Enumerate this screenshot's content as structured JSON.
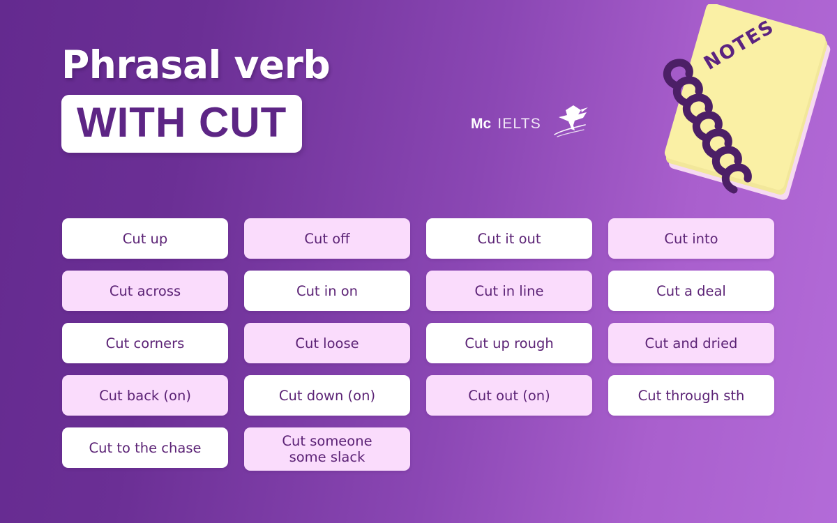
{
  "theme": {
    "bg_gradient_start": "#642a8f",
    "bg_gradient_end": "#b36bd8",
    "card_white": "#ffffff",
    "card_pink": "#fadcfc",
    "text_purple": "#5b2275",
    "notebook_yellow": "#faf0a5",
    "notebook_spiral": "#4c1f66"
  },
  "header": {
    "title_line1": "Phrasal verb",
    "title_line2": "WITH CUT"
  },
  "logo": {
    "mc": "Mc",
    "ielts": "IELTS",
    "bird_icon": "origami-bird-icon"
  },
  "notebook": {
    "label": "NOTES",
    "icon": "spiral-notebook-icon"
  },
  "grid": {
    "columns": 4,
    "cards": [
      {
        "label": "Cut up",
        "style": "white",
        "lines": 1
      },
      {
        "label": "Cut off",
        "style": "pink",
        "lines": 1
      },
      {
        "label": "Cut it out",
        "style": "white",
        "lines": 1
      },
      {
        "label": "Cut into",
        "style": "pink",
        "lines": 1
      },
      {
        "label": "Cut across",
        "style": "pink",
        "lines": 1
      },
      {
        "label": "Cut in on",
        "style": "white",
        "lines": 1
      },
      {
        "label": "Cut in line",
        "style": "pink",
        "lines": 1
      },
      {
        "label": "Cut a deal",
        "style": "white",
        "lines": 1
      },
      {
        "label": "Cut corners",
        "style": "white",
        "lines": 1
      },
      {
        "label": "Cut loose",
        "style": "pink",
        "lines": 1
      },
      {
        "label": "Cut up rough",
        "style": "white",
        "lines": 1
      },
      {
        "label": "Cut and dried",
        "style": "pink",
        "lines": 1
      },
      {
        "label": "Cut back (on)",
        "style": "pink",
        "lines": 1
      },
      {
        "label": "Cut down (on)",
        "style": "white",
        "lines": 1
      },
      {
        "label": "Cut out (on)",
        "style": "pink",
        "lines": 1
      },
      {
        "label": "Cut through sth",
        "style": "white",
        "lines": 1
      },
      {
        "label": "Cut to the chase",
        "style": "white",
        "lines": 1
      },
      {
        "label": "Cut someone\nsome slack",
        "style": "pink",
        "lines": 2
      }
    ]
  }
}
